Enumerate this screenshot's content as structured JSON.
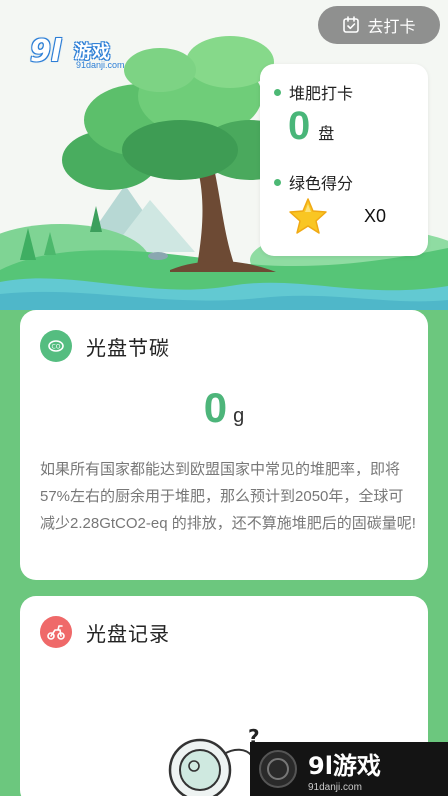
{
  "header": {
    "logo": {
      "mark": "9l",
      "name": "游戏",
      "site": "91danji.com"
    },
    "checkin_label": "去打卡"
  },
  "stats": {
    "compost_label": "堆肥打卡",
    "compost_value": "0",
    "compost_unit": "盘",
    "green_label": "绿色得分",
    "green_value": "X0"
  },
  "carbon_card": {
    "title": "光盘节碳",
    "value": "0",
    "unit": "g",
    "description": "如果所有国家都能达到欧盟国家中常见的堆肥率，即将57%左右的厨余用于堆肥，那么预计到2050年，全球可减少2.28GtCO2-eq 的排放，还不算施堆肥后的固碳量呢!"
  },
  "record_card": {
    "title": "光盘记录",
    "mascot_mark": "?"
  },
  "watermark": {
    "name": "9l游戏",
    "site": "91danji.com"
  },
  "colors": {
    "background": "#6cc77e",
    "accent": "#4db57a",
    "record_badge": "#ef6969"
  }
}
